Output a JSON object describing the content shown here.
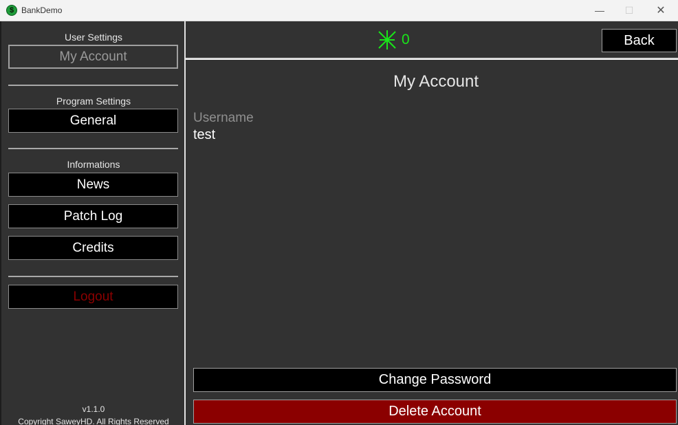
{
  "window": {
    "title": "BankDemo",
    "icon": "dollar-icon",
    "controls": {
      "minimize": "—",
      "maximize": "☐",
      "close": "✕"
    }
  },
  "sidebar": {
    "user_settings_label": "User Settings",
    "my_account_label": "My Account",
    "program_settings_label": "Program Settings",
    "general_label": "General",
    "informations_label": "Informations",
    "news_label": "News",
    "patch_log_label": "Patch Log",
    "credits_label": "Credits",
    "logout_label": "Logout",
    "version": "v1.1.0",
    "copyright": "Copyright SaweyHD. All Rights Reserved"
  },
  "header": {
    "balance_icon": "currency-icon",
    "balance": "0",
    "back_label": "Back"
  },
  "main": {
    "title": "My Account",
    "username_label": "Username",
    "username_value": "test",
    "change_password_label": "Change Password",
    "delete_account_label": "Delete Account"
  },
  "colors": {
    "background": "#323232",
    "accent_green": "#19e619",
    "danger": "#8b0000",
    "button_bg": "#000000"
  }
}
